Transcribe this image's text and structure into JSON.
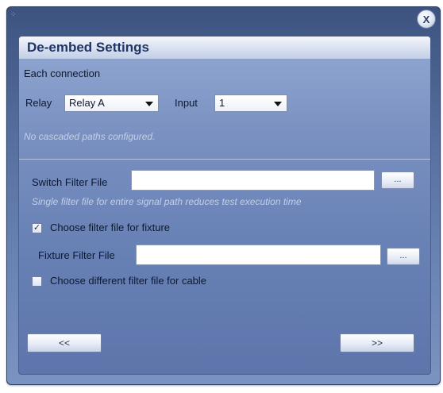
{
  "window": {
    "close_label": "X"
  },
  "dialog": {
    "title": "De-embed Settings",
    "section_label": "Each connection",
    "relay": {
      "label": "Relay",
      "value": "Relay A"
    },
    "input": {
      "label": "Input",
      "value": "1"
    },
    "no_paths_text": "No cascaded paths configured.",
    "switch_filter": {
      "label": "Switch Filter File",
      "value": "",
      "browse_label": "...",
      "hint": "Single filter file for entire signal path reduces test execution time"
    },
    "fixture_checkbox": {
      "label": "Choose filter file for fixture",
      "checked": true,
      "check_glyph": "✓"
    },
    "fixture_filter": {
      "label": "Fixture Filter File",
      "value": "",
      "browse_label": "..."
    },
    "cable_checkbox": {
      "label": "Choose different filter file for cable",
      "checked": false
    },
    "back_label": "<<",
    "next_label": ">>"
  }
}
